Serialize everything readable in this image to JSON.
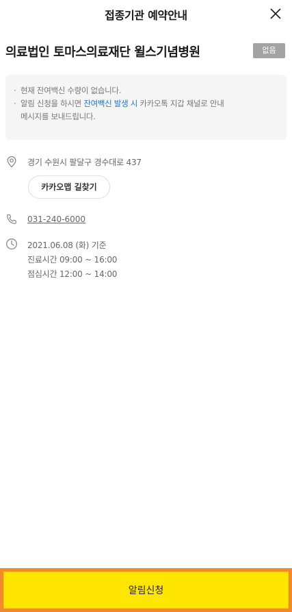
{
  "header": {
    "title": "접종기관 예약안내",
    "close_icon": "close-icon"
  },
  "hospital": {
    "name": "의료법인 토마스의료재단 윌스기념병원",
    "status_badge": "없음"
  },
  "notice": {
    "line1": "현재 잔여백신 수량이 없습니다.",
    "line2_prefix": "알림 신청을 하시면 ",
    "line2_highlight": "잔여백신 발생 시",
    "line2_suffix": " 카카오톡 지갑 채널로 안내",
    "line3": "메시지를 보내드립니다.",
    "highlight_color": "#1f74d6"
  },
  "address": {
    "icon": "location-pin-icon",
    "text": "경기 수원시 팔달구 경수대로 437",
    "map_button": "카카오맵 길찾기"
  },
  "phone": {
    "icon": "phone-icon",
    "number": "031-240-6000"
  },
  "hours": {
    "icon": "clock-icon",
    "base_date": "2021.06.08 (화) 기준",
    "clinic_hours": "진료시간 09:00 ~ 16:00",
    "lunch_hours": "점심시간 12:00 ~ 14:00"
  },
  "cta": {
    "label": "알림신청",
    "bg_color": "#ffe600",
    "border_highlight": "#f08a2b"
  }
}
